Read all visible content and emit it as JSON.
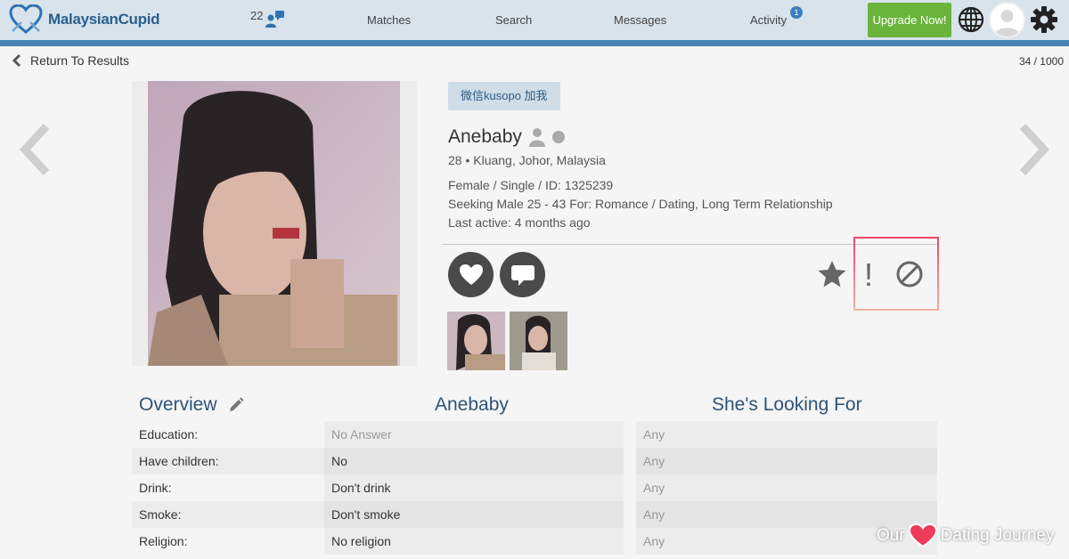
{
  "header": {
    "logo_text": "MalaysianCupid",
    "message_count": "22",
    "nav": [
      "Matches",
      "Search",
      "Messages",
      "Activity"
    ],
    "activity_badge": "1",
    "upgrade_label": "Upgrade Now!",
    "accent_color": "#4a82b4",
    "upgrade_color": "#6bb43b"
  },
  "subheader": {
    "back_label": "Return To Results",
    "pager": "34 / 1000"
  },
  "profile": {
    "tagline": "微信kusopo 加我",
    "name": "Anebaby",
    "location": "28 • Kluang, Johor, Malaysia",
    "details": "Female / Single / ID: 1325239",
    "seeking": "Seeking Male 25 - 43 For: Romance / Dating, Long Term Relationship",
    "last_active": "Last active: 4 months ago"
  },
  "overview": {
    "title": "Overview",
    "col2_title": "Anebaby",
    "col3_title": "She's Looking For",
    "rows": [
      {
        "label": "Education:",
        "value": "No Answer",
        "looking": "Any"
      },
      {
        "label": "Have children:",
        "value": "No",
        "looking": "Any"
      },
      {
        "label": "Drink:",
        "value": "Don't drink",
        "looking": "Any"
      },
      {
        "label": "Smoke:",
        "value": "Don't smoke",
        "looking": "Any"
      },
      {
        "label": "Religion:",
        "value": "No religion",
        "looking": "Any"
      }
    ]
  },
  "watermark": {
    "left": "Our",
    "right": "Dating Journey"
  }
}
